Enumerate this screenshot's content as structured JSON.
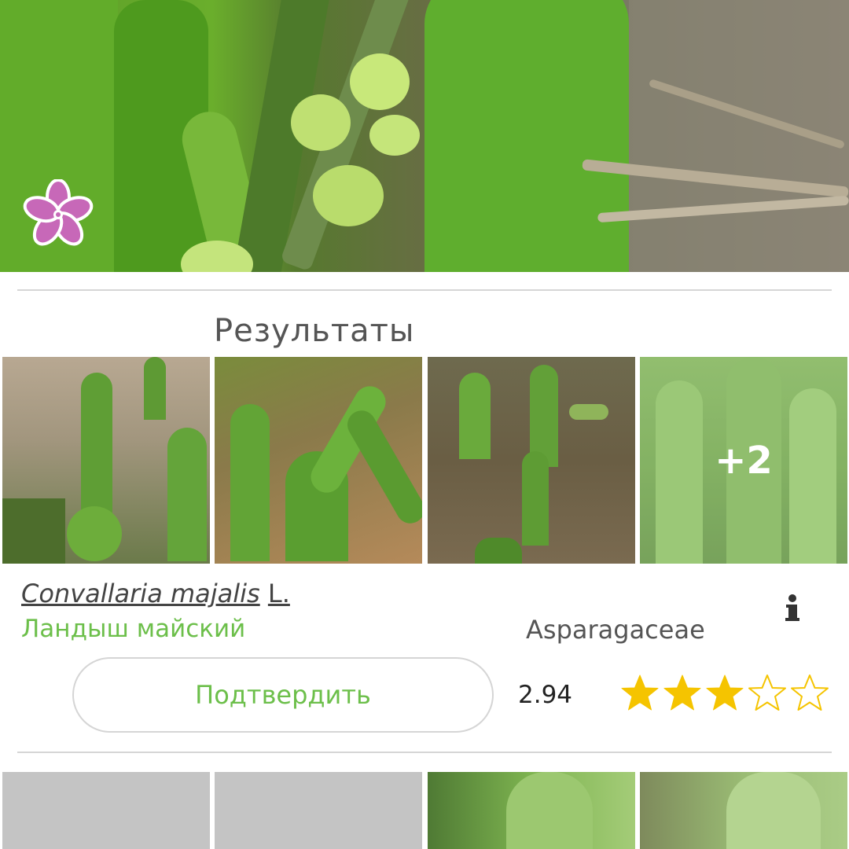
{
  "results": {
    "title": "Результаты",
    "more_count": "+2"
  },
  "species": {
    "latin_genus_species": "Convallaria majalis",
    "author": "L.",
    "common_name": "Ландыш майский",
    "family": "Asparagaceae"
  },
  "confirm_button": {
    "label": "Подтвердить"
  },
  "rating": {
    "score": "2.94",
    "stars_filled": 3,
    "stars_total": 5,
    "star_color": "#f5c400"
  },
  "icons": {
    "logo": "flower-icon",
    "info": "info-icon"
  },
  "colors": {
    "accent_green": "#6cbf4a",
    "divider": "#d6d6d6"
  }
}
